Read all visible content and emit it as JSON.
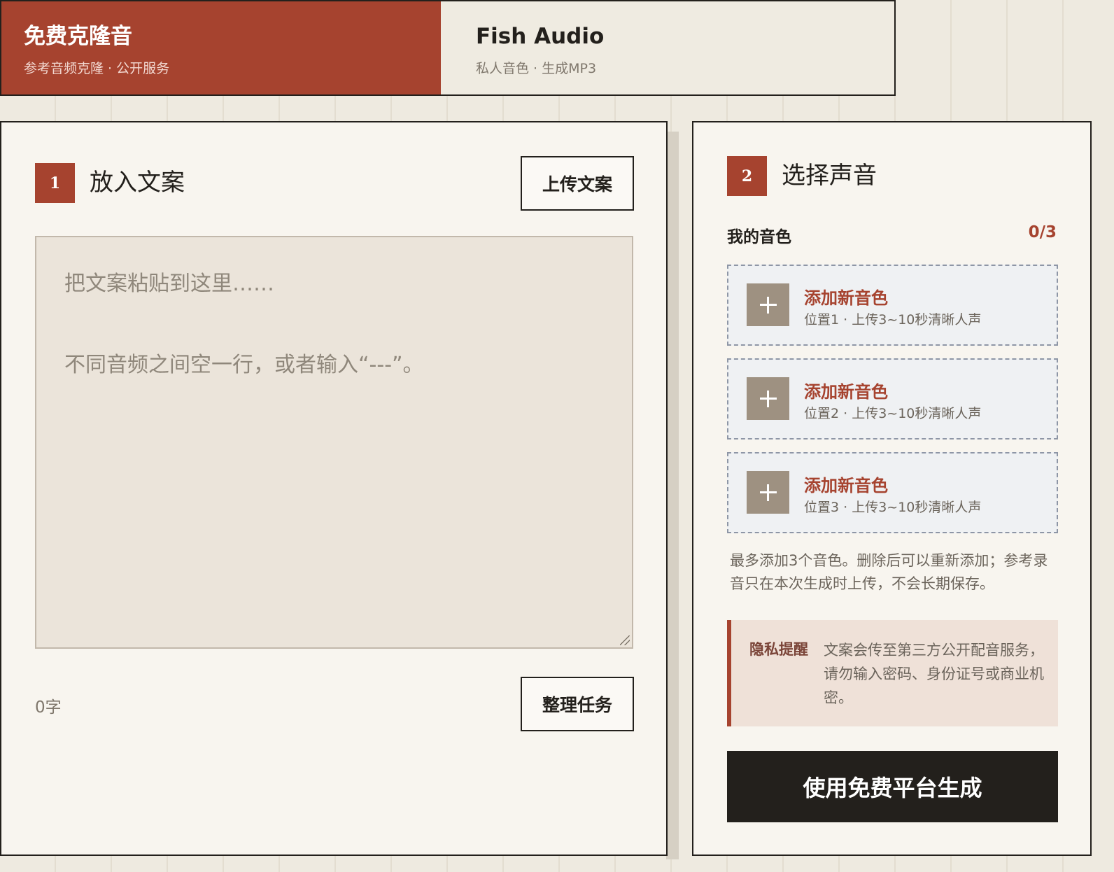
{
  "tabs": [
    {
      "title": "免费克隆音",
      "subtitle": "参考音频克隆 · 公开服务"
    },
    {
      "title": "Fish Audio",
      "subtitle": "私人音色 · 生成MP3"
    }
  ],
  "left": {
    "step": "1",
    "title": "放入文案",
    "upload_label": "上传文案",
    "textarea_placeholder_line1": "把文案粘贴到这里……",
    "textarea_placeholder_line2": "不同音频之间空一行，或者输入“---”。",
    "char_count": "0字",
    "organize_label": "整理任务"
  },
  "right": {
    "step": "2",
    "title": "选择声音",
    "my_voices_label": "我的音色",
    "my_voices_count": "0/3",
    "slots": [
      {
        "title": "添加新音色",
        "subtitle": "位置1 · 上传3~10秒清晰人声"
      },
      {
        "title": "添加新音色",
        "subtitle": "位置2 · 上传3~10秒清晰人声"
      },
      {
        "title": "添加新音色",
        "subtitle": "位置3 · 上传3~10秒清晰人声"
      }
    ],
    "note": "最多添加3个音色。删除后可以重新添加；参考录音只在本次生成时上传，不会长期保存。",
    "privacy_label": "隐私提醒",
    "privacy_text": "文案会传至第三方公开配音服务，请勿输入密码、身份证号或商业机密。",
    "generate_label": "使用免费平台生成"
  },
  "colors": {
    "accent": "#a6432f",
    "background": "#eeeae0",
    "panel": "#f8f5ef",
    "dark": "#23201c"
  },
  "icons": [
    "plus-icon",
    "resize-grip-icon"
  ]
}
